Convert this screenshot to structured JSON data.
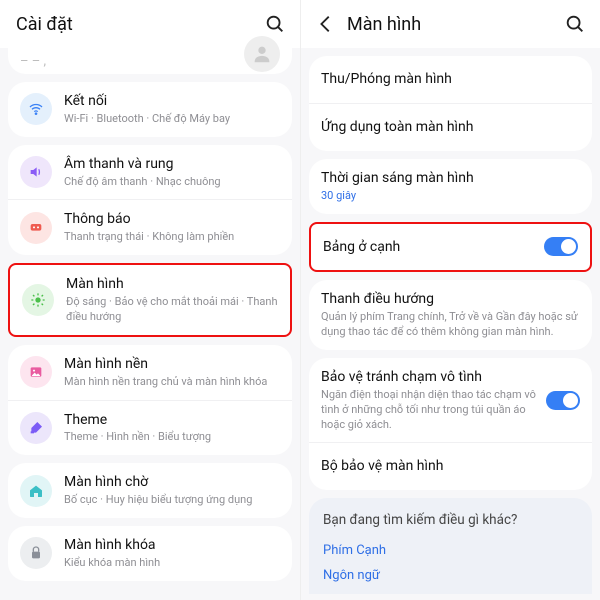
{
  "left": {
    "header": {
      "title": "Cài đặt"
    },
    "cutoff_placeholder": "– – ,",
    "items": [
      {
        "icon": "wifi",
        "bg": "bg-blue",
        "fg": "fg-blue",
        "title": "Kết nối",
        "sub": "Wi-Fi · Bluetooth · Chế độ Máy bay"
      },
      {
        "icon": "sound",
        "bg": "bg-purple",
        "fg": "fg-purple",
        "title": "Âm thanh và rung",
        "sub": "Chế độ âm thanh · Nhạc chuông"
      },
      {
        "icon": "bell",
        "bg": "bg-red",
        "fg": "fg-red",
        "title": "Thông báo",
        "sub": "Thanh trạng thái · Không làm phiền"
      },
      {
        "icon": "sun",
        "bg": "bg-green",
        "fg": "fg-green",
        "title": "Màn hình",
        "sub": "Độ sáng · Bảo vệ cho mắt thoải mái · Thanh điều hướng",
        "highlight": true
      },
      {
        "icon": "image",
        "bg": "bg-pink",
        "fg": "fg-pink",
        "title": "Màn hình nền",
        "sub": "Màn hình nền trang chủ và màn hình khóa"
      },
      {
        "icon": "brush",
        "bg": "bg-violet",
        "fg": "fg-violet",
        "title": "Theme",
        "sub": "Theme · Hình nền · Biểu tượng"
      },
      {
        "icon": "home",
        "bg": "bg-teal",
        "fg": "fg-teal",
        "title": "Màn hình chờ",
        "sub": "Bố cục · Huy hiệu biểu tượng ứng dụng"
      },
      {
        "icon": "lock",
        "bg": "bg-gray",
        "fg": "fg-gray",
        "title": "Màn hình khóa",
        "sub": "Kiểu khóa màn hình"
      }
    ]
  },
  "right": {
    "header": {
      "title": "Màn hình"
    },
    "groups": [
      [
        {
          "title": "Thu/Phóng màn hình"
        },
        {
          "title": "Ứng dụng toàn màn hình"
        }
      ],
      [
        {
          "title": "Thời gian sáng màn hình",
          "sub": "30 giây",
          "subClass": "blue"
        }
      ],
      [
        {
          "title": "Bảng ở cạnh",
          "toggle": true,
          "highlight": true
        }
      ],
      [
        {
          "title": "Thanh điều hướng",
          "sub": "Quản lý phím Trang chính, Trở về và Gần đây hoặc sử dụng thao tác để có thêm không gian màn hình."
        }
      ],
      [
        {
          "title": "Bảo vệ tránh chạm vô tình",
          "sub": "Ngăn điện thoại nhận diện thao tác chạm vô tình ở những chỗ tối như trong túi quần áo hoặc giỏ xách.",
          "toggle": true
        },
        {
          "title": "Bộ bảo vệ màn hình"
        }
      ]
    ],
    "suggest": {
      "title": "Bạn đang tìm kiếm điều gì khác?",
      "links": [
        "Phím Cạnh",
        "Ngôn ngữ"
      ]
    }
  }
}
